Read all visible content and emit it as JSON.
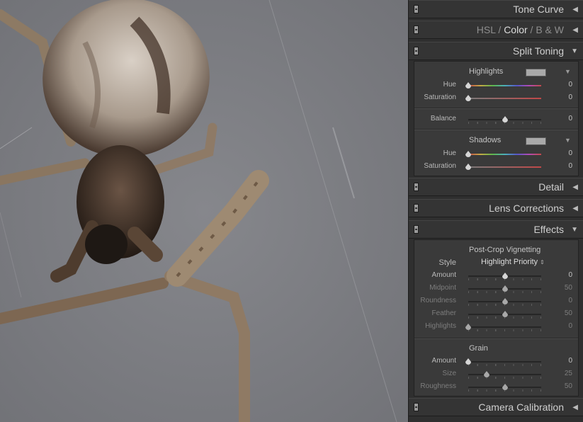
{
  "panels": {
    "tone_curve": {
      "title": "Tone Curve"
    },
    "hsl": {
      "tabs": [
        "HSL",
        "Color",
        "B & W"
      ],
      "separator": "/",
      "active_tab": "Color"
    },
    "split_toning": {
      "title": "Split Toning",
      "highlights": {
        "label": "Highlights",
        "hue": {
          "label": "Hue",
          "value": "0"
        },
        "saturation": {
          "label": "Saturation",
          "value": "0"
        }
      },
      "balance": {
        "label": "Balance",
        "value": "0"
      },
      "shadows": {
        "label": "Shadows",
        "hue": {
          "label": "Hue",
          "value": "0"
        },
        "saturation": {
          "label": "Saturation",
          "value": "0"
        }
      }
    },
    "detail": {
      "title": "Detail"
    },
    "lens_corrections": {
      "title": "Lens Corrections"
    },
    "effects": {
      "title": "Effects",
      "vignetting": {
        "label": "Post-Crop Vignetting",
        "style_label": "Style",
        "style_value": "Highlight Priority",
        "amount": {
          "label": "Amount",
          "value": "0"
        },
        "midpoint": {
          "label": "Midpoint",
          "value": "50"
        },
        "roundness": {
          "label": "Roundness",
          "value": "0"
        },
        "feather": {
          "label": "Feather",
          "value": "50"
        },
        "highlights": {
          "label": "Highlights",
          "value": "0"
        }
      },
      "grain": {
        "label": "Grain",
        "amount": {
          "label": "Amount",
          "value": "0"
        },
        "size": {
          "label": "Size",
          "value": "25"
        },
        "roughness": {
          "label": "Roughness",
          "value": "50"
        }
      }
    },
    "camera_calibration": {
      "title": "Camera Calibration"
    }
  },
  "slider_positions": {
    "st_h_hue": 0,
    "st_h_sat": 0,
    "st_balance": 0.5,
    "st_s_hue": 0,
    "st_s_sat": 0,
    "v_amount": 0.5,
    "v_midpoint": 0.5,
    "v_roundness": 0.5,
    "v_feather": 0.5,
    "v_highlights": 0,
    "g_amount": 0,
    "g_size": 0.25,
    "g_roughness": 0.5
  },
  "icons": {
    "collapse": "triangle-left-icon",
    "expand": "triangle-down-icon",
    "panel_switch": "panel-switch-icon"
  },
  "colors": {
    "panel_bg": "#2f2f2f",
    "photo_bg": "#808187",
    "text": "#cfcfcf"
  }
}
